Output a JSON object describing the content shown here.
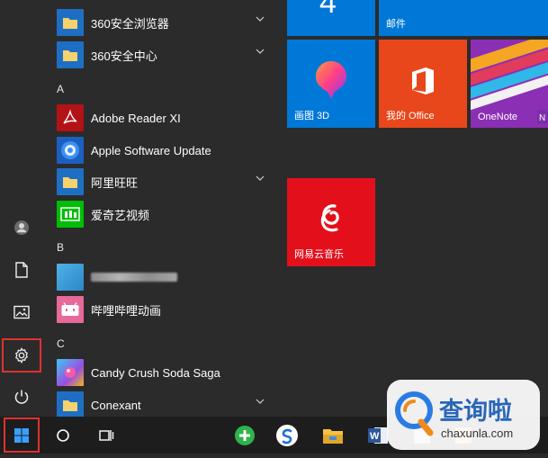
{
  "app_list": {
    "items": [
      {
        "label": "360安全浏览器",
        "icon": "folder-icon",
        "expandable": true
      },
      {
        "label": "360安全中心",
        "icon": "folder-icon",
        "expandable": true
      },
      {
        "label": "Adobe Reader XI",
        "icon": "adobe-reader-icon",
        "expandable": false
      },
      {
        "label": "Apple Software Update",
        "icon": "apple-update-icon",
        "expandable": false
      },
      {
        "label": "阿里旺旺",
        "icon": "folder-icon",
        "expandable": true
      },
      {
        "label": "爱奇艺视频",
        "icon": "iqiyi-icon",
        "expandable": false
      },
      {
        "label": "",
        "icon": "blurred-app-icon",
        "expandable": false
      },
      {
        "label": "哔哩哔哩动画",
        "icon": "bilibili-icon",
        "expandable": false
      },
      {
        "label": "Candy Crush Soda Saga",
        "icon": "candy-crush-icon",
        "expandable": false
      },
      {
        "label": "Conexant",
        "icon": "folder-icon",
        "expandable": true
      }
    ],
    "section_letters": [
      "A",
      "B",
      "C"
    ]
  },
  "tiles": {
    "calendar_number": "4",
    "mail_label": "邮件",
    "paint3d_label": "画图 3D",
    "office_label": "我的 Office",
    "onenote_label": "OneNote",
    "netease_label": "网易云音乐"
  },
  "left_rail": {
    "icons": [
      "user-icon",
      "document-icon",
      "pictures-icon",
      "settings-icon",
      "power-icon"
    ],
    "selected": "settings-icon"
  },
  "taskbar": {
    "icons": [
      "windows-start-icon",
      "search-circle-icon",
      "task-view-icon",
      "app-green-icon",
      "sogou-icon",
      "file-explorer-icon",
      "word-icon",
      "app-icon",
      "app-icon"
    ]
  },
  "watermark": {
    "title": "查询啦",
    "url": "chaxunla.com"
  },
  "colors": {
    "tile_blue": "#0078d7",
    "office_orange": "#e8471b",
    "netease_red": "#e3101c",
    "highlight_red": "#e0312f",
    "start_bg": "#2b2b2b",
    "folder_yellow": "#f5d26b"
  }
}
